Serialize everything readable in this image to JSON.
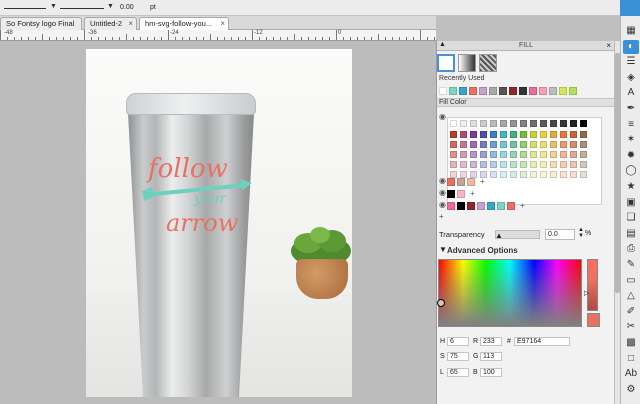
{
  "toolbar": {
    "stroke_value": "0.00",
    "unit": "pt"
  },
  "tabs": [
    {
      "label": "So Fontsy logo Final"
    },
    {
      "label": "Untitled-2"
    },
    {
      "label": "hm-svg-follow-you..."
    }
  ],
  "ruler": {
    "labels": [
      "-48",
      "-36",
      "-24",
      "-12",
      "0"
    ]
  },
  "design": {
    "lines": [
      "follow",
      "your",
      "arrow"
    ],
    "colors": {
      "text": "#e97164",
      "accent": "#6fd0bd"
    }
  },
  "fill_panel": {
    "title": "FILL",
    "recently_used_label": "Recently Used",
    "fill_color_label": "Fill Color",
    "recently_used": [
      "#ffffff",
      "#7dd6c4",
      "#3aa7c9",
      "#e97164",
      "#c7a2c9",
      "#aaaaaa",
      "#555555",
      "#8b2a2a",
      "#333333",
      "#ea6b9c",
      "#f6a2b6",
      "#bebebe",
      "#d4e75a",
      "#b3e05a"
    ],
    "grayscale": [
      "#ffffff",
      "#f0f0f0",
      "#dedede",
      "#cccccc",
      "#bbbbbb",
      "#a8a8a8",
      "#959595",
      "#828282",
      "#6f6f6f",
      "#5c5c5c",
      "#494949",
      "#363636",
      "#222222",
      "#000000"
    ],
    "palette_hues": [
      "#c0392b",
      "#b24a7a",
      "#7a3e9d",
      "#4a4fb0",
      "#3b7fc9",
      "#3fb7c4",
      "#3fb37b",
      "#6fbf3b",
      "#c5d33a",
      "#e8d23a",
      "#e7a93a",
      "#e7793a",
      "#c8643b",
      "#8c6a4a"
    ],
    "user_row1": [
      "#e97164",
      "#c4a59a",
      "#f0b9a5"
    ],
    "user_row2": [
      "#000000",
      "#f2b8c6"
    ],
    "user_row3": [
      "#ea6b9c",
      "#000000",
      "#8b2a2a",
      "#c7a2c9",
      "#3aa7c9",
      "#7dd6c4",
      "#e97164"
    ],
    "transparency_label": "Transparency",
    "transparency_value": "0.0",
    "transparency_unit": "%",
    "advanced_label": "Advanced Options",
    "h_label": "H",
    "h_value": "6",
    "s_label": "S",
    "s_value": "75",
    "l_label": "L",
    "l_value": "65",
    "r_label": "R",
    "r_value": "233",
    "g_label": "G",
    "g_value": "113",
    "b_label": "B",
    "b_value": "100",
    "hex_label": "#",
    "hex_value": "E97164",
    "current_color": "#e97164"
  },
  "iconbar": {
    "icons": [
      "cut-settings-icon",
      "fill-icon",
      "transform-icon",
      "trace-icon",
      "text-icon",
      "sketch-icon",
      "align-icon",
      "replicate-icon",
      "weld-icon",
      "offset-icon",
      "star-icon",
      "modify-icon",
      "layers-icon",
      "library-icon",
      "print-icon",
      "pen-icon",
      "eraser-icon",
      "shape-icon",
      "brush-icon",
      "knife-icon",
      "grid-icon",
      "page-icon",
      "text-style-icon",
      "settings-icon"
    ],
    "glyphs": [
      "▦",
      "◐",
      "☰",
      "◈",
      "A",
      "✒",
      "≡",
      "✶",
      "✹",
      "◯",
      "★",
      "▣",
      "❑",
      "▤",
      "⎙",
      "✎",
      "▭",
      "△",
      "✐",
      "✂",
      "▩",
      "□",
      "Ab",
      "⚙"
    ]
  }
}
